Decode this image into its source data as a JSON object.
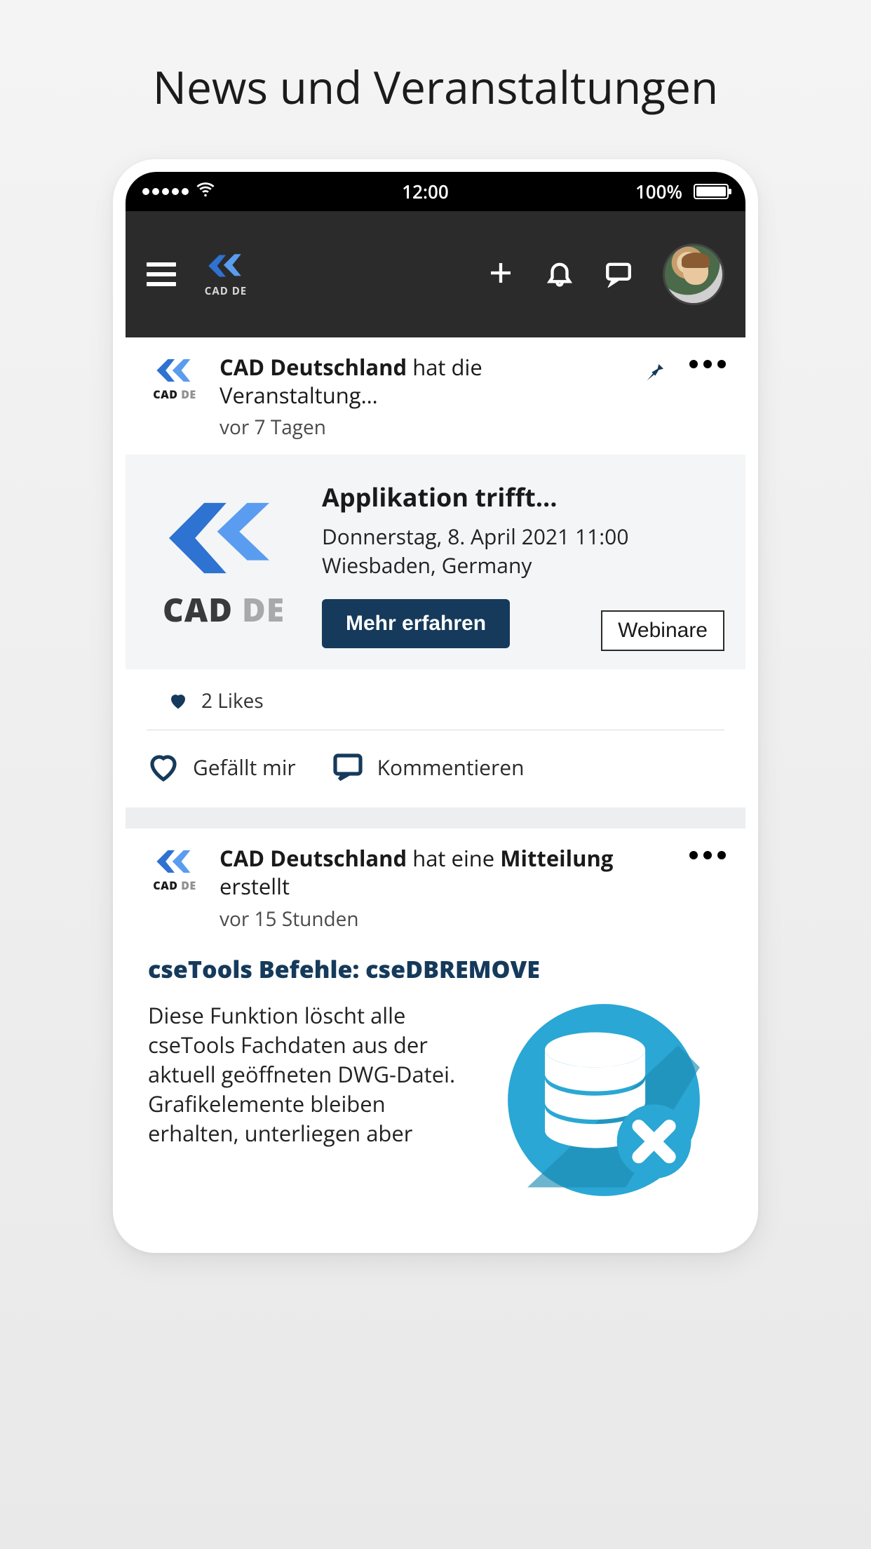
{
  "page_heading": "News und Veranstaltungen",
  "status_bar": {
    "time": "12:00",
    "battery_pct": "100%"
  },
  "header": {
    "logo_text": "CAD DE"
  },
  "posts": [
    {
      "author": "CAD Deutschland",
      "author_logo_text_main": "CAD",
      "author_logo_text_sub": "DE",
      "action_text": " hat die Veranstaltung…",
      "time": "vor 7 Tagen",
      "pinned": true,
      "event": {
        "logo_text_main": "CAD",
        "logo_text_sub": "DE",
        "title": "Applikation trifft…",
        "date": "Donnerstag, 8. April 2021 11:00",
        "location": "Wiesbaden, Germany",
        "cta_label": "Mehr erfahren",
        "tag_label": "Webinare"
      },
      "likes_label": "2 Likes",
      "like_action_label": "Gefällt mir",
      "comment_action_label": "Kommentieren"
    },
    {
      "author": "CAD Deutschland",
      "author_logo_text_main": "CAD",
      "author_logo_text_sub": "DE",
      "action_prefix": " hat eine ",
      "action_bold": "Mitteilung",
      "action_suffix": " erstellt",
      "time": "vor 15 Stunden",
      "title": "cseTools Befehle: cseDBREMOVE",
      "body_text": "Diese Funktion löscht alle cseTools Fachdaten aus der aktuell geöffneten DWG-Datei. Grafikelemente bleiben erhalten, unterliegen aber"
    }
  ]
}
